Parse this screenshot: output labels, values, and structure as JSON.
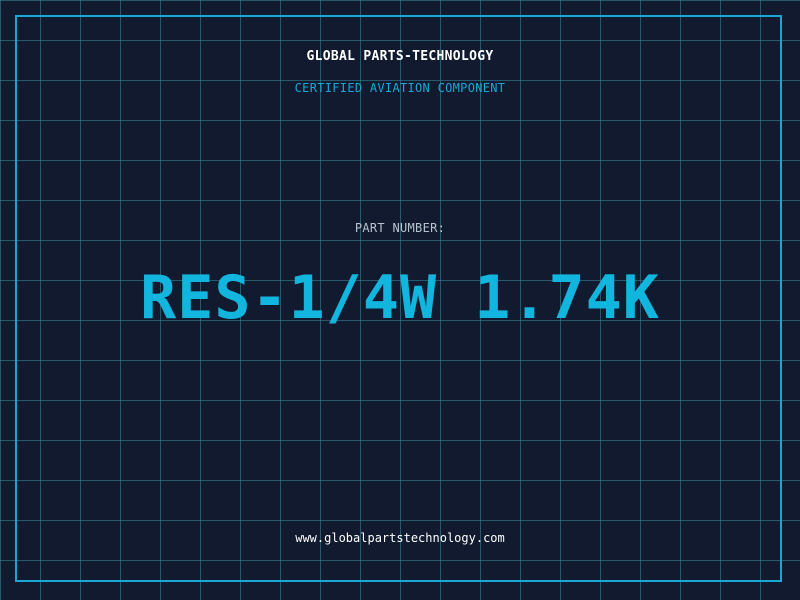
{
  "header": {
    "company": "GLOBAL PARTS-TECHNOLOGY",
    "subtitle": "CERTIFIED AVIATION COMPONENT"
  },
  "main": {
    "part_label": "PART NUMBER:",
    "part_number": "RES-1/4W 1.74K"
  },
  "footer": {
    "website": "www.globalpartstechnology.com"
  },
  "colors": {
    "background": "#111a2e",
    "grid": "#388ca0",
    "accent": "#1aa7d6",
    "part_number": "#12b5dd",
    "text_primary": "#ffffff",
    "text_muted": "#b7c3cf"
  }
}
